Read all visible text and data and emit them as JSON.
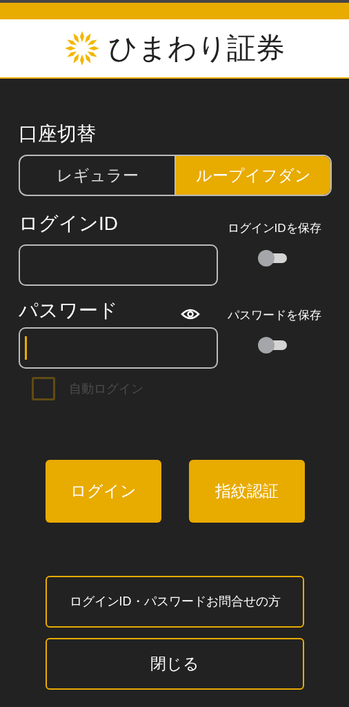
{
  "header": {
    "brand": "ひまわり証券"
  },
  "account_switch": {
    "label": "口座切替",
    "options": [
      {
        "label": "レギュラー",
        "selected": false
      },
      {
        "label": "ループイフダン",
        "selected": true
      }
    ]
  },
  "login_id": {
    "label": "ログインID",
    "save_label": "ログインIDを保存",
    "save_on": false
  },
  "password": {
    "label": "パスワード",
    "focused": true,
    "save_label": "パスワードを保存",
    "save_on": false
  },
  "auto_login": {
    "label": "自動ログイン",
    "checked": false,
    "disabled": true
  },
  "actions": [
    "ログイン",
    "指紋認証"
  ],
  "links": [
    "ログインID・パスワードお問合せの方",
    "閉じる"
  ]
}
